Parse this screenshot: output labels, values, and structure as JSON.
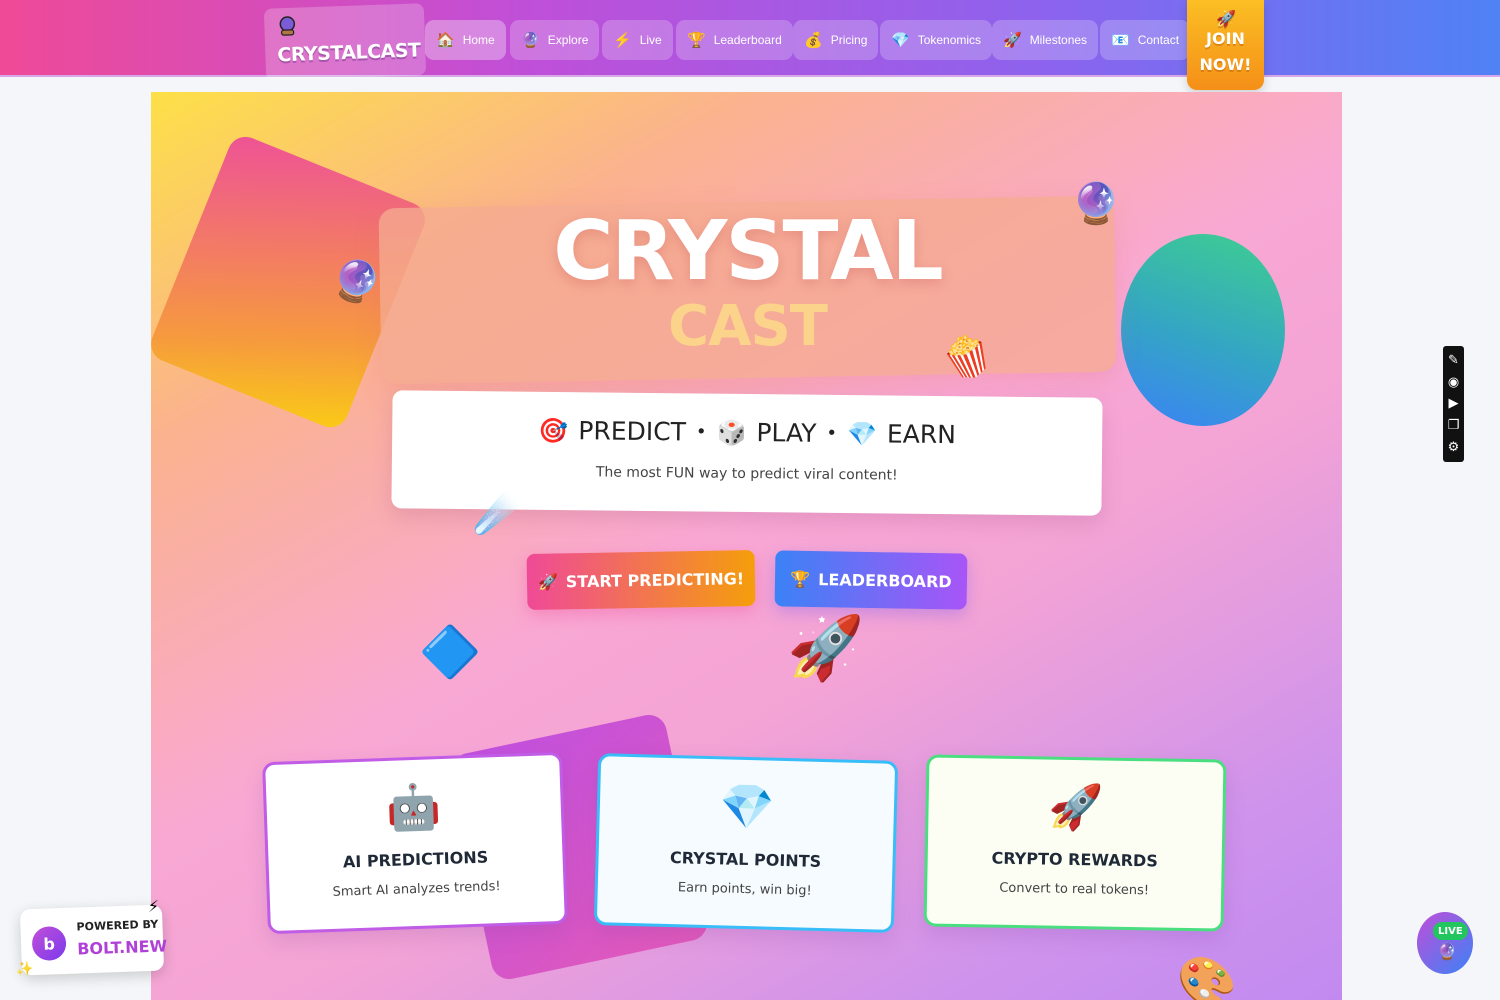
{
  "nav": {
    "brand": "CRYSTALCAST",
    "brand_icon": "crystal-ball-icon",
    "items": [
      {
        "label": "Home",
        "icon": "🏠"
      },
      {
        "label": "Explore",
        "icon": "🔮"
      },
      {
        "label": "Live",
        "icon": "⚡"
      },
      {
        "label": "Leaderboard",
        "icon": "🏆"
      },
      {
        "label": "Pricing",
        "icon": "💰"
      },
      {
        "label": "Tokenomics",
        "icon": "💎"
      },
      {
        "label": "Milestones",
        "icon": "🚀"
      },
      {
        "label": "Contact",
        "icon": "📧"
      }
    ],
    "join_line1": "JOIN",
    "join_line2": "NOW!",
    "join_icon": "🚀"
  },
  "hero": {
    "title": "CRYSTAL",
    "subtitle": "CAST",
    "tagline": {
      "predict": "PREDICT",
      "play": "PLAY",
      "earn": "EARN",
      "sep": "•",
      "predict_icon": "🎯",
      "play_icon": "🎲",
      "earn_icon": "💎",
      "description": "The most FUN way to predict viral content!"
    },
    "cta_primary": {
      "label": "START PREDICTING!",
      "icon": "🚀"
    },
    "cta_secondary": {
      "label": "LEADERBOARD",
      "icon": "🏆"
    }
  },
  "features": [
    {
      "icon": "🤖",
      "title": "AI PREDICTIONS",
      "description": "Smart AI analyzes trends!"
    },
    {
      "icon": "💎",
      "title": "CRYSTAL POINTS",
      "description": "Earn points, win big!"
    },
    {
      "icon": "🚀",
      "title": "CRYPTO REWARDS",
      "description": "Convert to real tokens!"
    }
  ],
  "floaters": {
    "orb1": "🔮",
    "orb2": "🔮",
    "popcorn": "🍿",
    "comet": "☄️",
    "gem": "🔷",
    "rocket": "🚀",
    "palette": "🎨"
  },
  "toolbar": {
    "icons": [
      "pin-icon",
      "camera-icon",
      "video-icon",
      "window-icon",
      "gear-icon"
    ],
    "glyphs": [
      "✎",
      "◉",
      "▶",
      "❐",
      "⚙"
    ]
  },
  "bolt_badge": {
    "powered": "POWERED BY",
    "name": "BOLT.NEW",
    "logo": "b",
    "zap": "⚡",
    "spark": "✨"
  },
  "live_badge": {
    "label": "LIVE",
    "icon": "🔮"
  },
  "colors": {
    "nav_gradient_start": "#ef4a97",
    "nav_gradient_end": "#4f82f5",
    "cta_pink": "#ef4a97",
    "cta_orange": "#f59e0b",
    "cta_blue": "#3b82f6",
    "cta_purple": "#a855f7"
  }
}
